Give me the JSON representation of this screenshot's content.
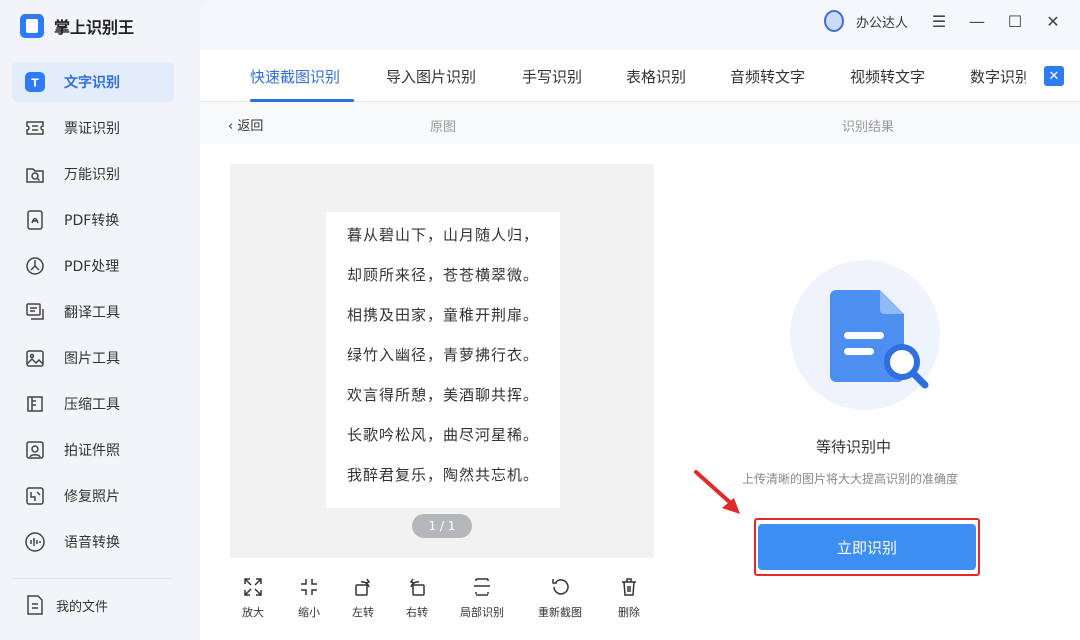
{
  "app": {
    "name": "掌上识别王"
  },
  "sidebar": {
    "items": [
      {
        "label": "文字识别",
        "icon": "text-recognition-icon"
      },
      {
        "label": "票证识别",
        "icon": "ticket-icon"
      },
      {
        "label": "万能识别",
        "icon": "universal-search-icon"
      },
      {
        "label": "PDF转换",
        "icon": "pdf-convert-icon"
      },
      {
        "label": "PDF处理",
        "icon": "pdf-process-icon"
      },
      {
        "label": "翻译工具",
        "icon": "translate-icon"
      },
      {
        "label": "图片工具",
        "icon": "image-icon"
      },
      {
        "label": "压缩工具",
        "icon": "compress-icon"
      },
      {
        "label": "拍证件照",
        "icon": "id-photo-icon"
      },
      {
        "label": "修复照片",
        "icon": "repair-photo-icon"
      },
      {
        "label": "语音转换",
        "icon": "voice-icon"
      }
    ],
    "files_label": "我的文件"
  },
  "titlebar": {
    "user_name": "办公达人"
  },
  "tabs": [
    "快速截图识别",
    "导入图片识别",
    "手写识别",
    "表格识别",
    "音频转文字",
    "视频转文字",
    "数字识别"
  ],
  "subbar": {
    "back": "返回",
    "original": "原图",
    "result": "识别结果"
  },
  "poem_lines": [
    "暮从碧山下，山月随人归，",
    "却顾所来径，苍苍横翠微。",
    "相携及田家，童稚开荆扉。",
    "绿竹入幽径，青萝拂行衣。",
    "欢言得所憩，美酒聊共挥。",
    "长歌吟松风，曲尽河星稀。",
    "我醉君复乐，陶然共忘机。"
  ],
  "pager": "1 / 1",
  "tools": [
    "放大",
    "缩小",
    "左转",
    "右转",
    "局部识别",
    "重新截图",
    "删除"
  ],
  "status": {
    "title": "等待识别中",
    "hint": "上传清晰的图片将大大提高识别的准确度"
  },
  "recognize_button": "立即识别",
  "colors": {
    "accent": "#2f6fe0",
    "button": "#3d8ef2",
    "highlight": "#e02a2a"
  }
}
